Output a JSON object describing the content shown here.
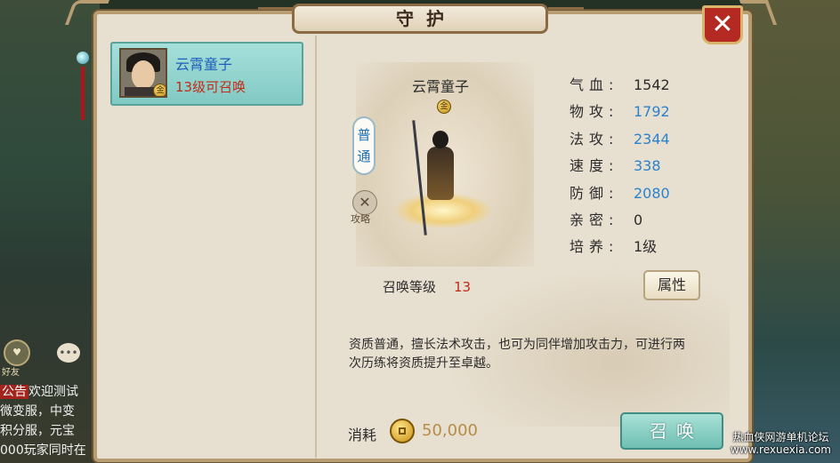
{
  "window": {
    "title": "守护",
    "close_label": "✕"
  },
  "side": {
    "friend_label": "好友",
    "chat": [
      {
        "tag": "公告",
        "text": "欢迎测试"
      },
      {
        "tag": "",
        "text": "微变服，中变"
      },
      {
        "tag": "",
        "text": "积分服，元宝"
      },
      {
        "tag": "",
        "text": "000玩家同时在"
      }
    ],
    "watermark_line1": "热血侠网游单机论坛",
    "watermark_line2": "www.rexuexia.com"
  },
  "guardian_list": [
    {
      "name": "云霄童子",
      "status": "13级可召唤",
      "grade": "金"
    }
  ],
  "detail": {
    "name": "云霄童子",
    "grade": "金",
    "quality": "普通",
    "guide_label": "攻略",
    "stats": [
      {
        "label": "气血:",
        "value": "1542",
        "color": "plain"
      },
      {
        "label": "物攻:",
        "value": "1792",
        "color": "blue"
      },
      {
        "label": "法攻:",
        "value": "2344",
        "color": "blue"
      },
      {
        "label": "速度:",
        "value": "338",
        "color": "blue"
      },
      {
        "label": "防御:",
        "value": "2080",
        "color": "blue"
      },
      {
        "label": "亲密:",
        "value": "0",
        "color": "plain"
      },
      {
        "label": "培养:",
        "value": "1级",
        "color": "plain"
      }
    ],
    "summon_level_label": "召唤等级",
    "summon_level": "13",
    "attr_button": "属性",
    "description": "资质普通，擅长法术攻击，也可为同伴增加攻击力，可进行两次历练将资质提升至卓越。",
    "cost_label": "消耗",
    "cost_value": "50,000",
    "summon_button": "召唤"
  },
  "colors": {
    "accent_teal": "#82c9c3",
    "value_blue": "#2d82cc",
    "value_red": "#c22a18",
    "close_red": "#b42a22"
  }
}
